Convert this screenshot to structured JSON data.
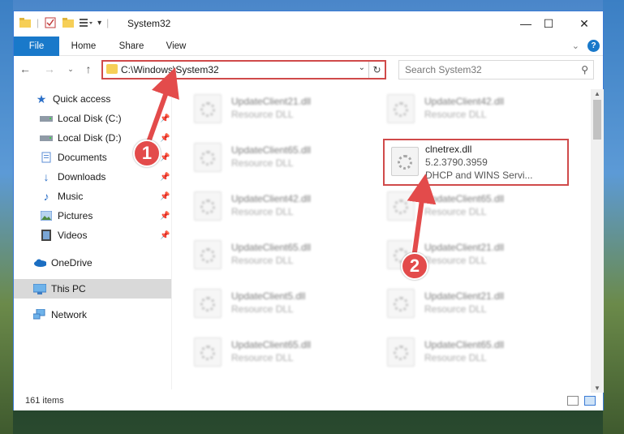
{
  "window": {
    "title": "System32",
    "controls": {
      "minimize": "—",
      "maximize": "☐",
      "close": "✕"
    }
  },
  "ribbon": {
    "tabs": [
      "File",
      "Home",
      "Share",
      "View"
    ]
  },
  "navbar": {
    "address": "C:\\Windows\\System32",
    "search_placeholder": "Search System32"
  },
  "sidebar": {
    "items": [
      {
        "label": "Quick access",
        "icon": "star-icon"
      },
      {
        "label": "Local Disk (C:)",
        "icon": "drive-icon",
        "pinned": true
      },
      {
        "label": "Local Disk (D:)",
        "icon": "drive-icon",
        "pinned": true
      },
      {
        "label": "Documents",
        "icon": "documents-icon",
        "pinned": true
      },
      {
        "label": "Downloads",
        "icon": "download-icon",
        "pinned": true
      },
      {
        "label": "Music",
        "icon": "music-icon",
        "pinned": true
      },
      {
        "label": "Pictures",
        "icon": "pictures-icon",
        "pinned": true
      },
      {
        "label": "Videos",
        "icon": "videos-icon",
        "pinned": true
      },
      {
        "label": "OneDrive",
        "icon": "cloud-icon"
      },
      {
        "label": "This PC",
        "icon": "pc-icon",
        "selected": true
      },
      {
        "label": "Network",
        "icon": "network-icon"
      }
    ]
  },
  "files": {
    "left_column": [
      {
        "name": "UpdateClient21.dll",
        "type": "Resource DLL"
      },
      {
        "name": "UpdateClient65.dll",
        "type": "Resource DLL"
      },
      {
        "name": "UpdateClient42.dll",
        "type": "Resource DLL"
      },
      {
        "name": "UpdateClient65.dll",
        "type": "Resource DLL"
      },
      {
        "name": "UpdateClient5.dll",
        "type": "Resource DLL"
      },
      {
        "name": "UpdateClient65.dll",
        "type": "Resource DLL"
      }
    ],
    "right_column": [
      {
        "name": "UpdateClient42.dll",
        "type": "Resource DLL"
      },
      {
        "name": "UpdateClient65.dll",
        "type": "Resource DLL"
      },
      {
        "name": "UpdateClient21.dll",
        "type": "Resource DLL"
      },
      {
        "name": "UpdateClient21.dll",
        "type": "Resource DLL"
      },
      {
        "name": "UpdateClient65.dll",
        "type": "Resource DLL"
      }
    ],
    "highlighted": {
      "name": "clnetrex.dll",
      "version": "5.2.3790.3959",
      "description": "DHCP and WINS Servi..."
    }
  },
  "status": {
    "item_count": "161 items"
  },
  "annotations": {
    "step1": "1",
    "step2": "2",
    "highlight_color": "#d04a4a",
    "badge_color": "#e34b4b"
  }
}
